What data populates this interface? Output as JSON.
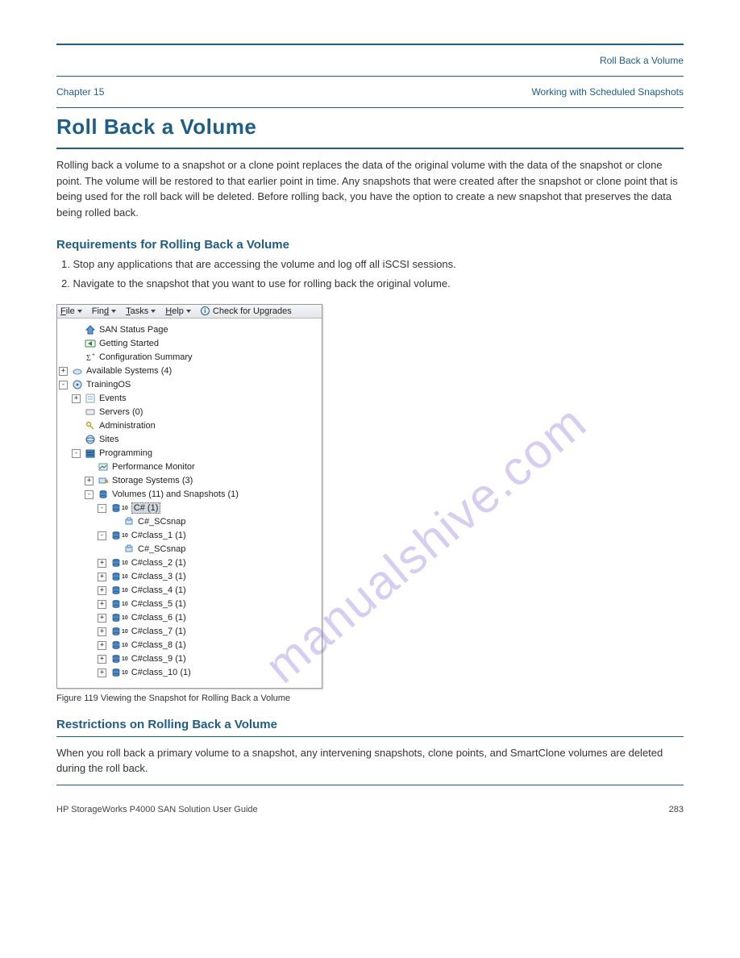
{
  "header_right": "Roll Back a Volume",
  "chapter_left": "Chapter 15",
  "chapter_right": "Working with Scheduled Snapshots",
  "title": "Roll Back a Volume",
  "intro": "Rolling back a volume to a snapshot or a clone point replaces the data of the original volume with the data of the snapshot or clone point. The volume will be restored to that earlier point in time. Any snapshots that were created after the snapshot or clone point that is being used for the roll back will be deleted. Before rolling back, you have the option to create a new snapshot that preserves the data being rolled back.",
  "subhead_req": "Requirements for Rolling Back a Volume",
  "req1": "1. Stop any applications that are accessing the volume and log off all iSCSI sessions.",
  "req2": "2. Navigate to the snapshot that you want to use for rolling back the original volume.",
  "menubar": {
    "file": "File",
    "find": "Find",
    "tasks": "Tasks",
    "help": "Help",
    "check": "Check for Upgrades"
  },
  "tree": {
    "san_status": "SAN Status Page",
    "getting_started": "Getting Started",
    "config_summary": "Configuration Summary",
    "available_systems": "Available Systems (4)",
    "trainingos": "TrainingOS",
    "events": "Events",
    "servers": "Servers (0)",
    "administration": "Administration",
    "sites": "Sites",
    "programming": "Programming",
    "perf_monitor": "Performance Monitor",
    "storage_systems": "Storage Systems (3)",
    "volumes": "Volumes (11) and Snapshots (1)",
    "csharp": "C# (1)",
    "scsnap1": "C#_SCsnap",
    "cc1": "C#class_1 (1)",
    "scsnap2": "C#_SCsnap",
    "cc2": "C#class_2 (1)",
    "cc3": "C#class_3 (1)",
    "cc4": "C#class_4 (1)",
    "cc5": "C#class_5 (1)",
    "cc6": "C#class_6 (1)",
    "cc7": "C#class_7 (1)",
    "cc8": "C#class_8 (1)",
    "cc9": "C#class_9 (1)",
    "cc10": "C#class_10 (1)"
  },
  "figure_caption": "Figure 119 Viewing the Snapshot for Rolling Back a Volume",
  "lower_head": "Restrictions on Rolling Back a Volume",
  "lower_body": "When you roll back a primary volume to a snapshot, any intervening snapshots, clone points, and SmartClone volumes are deleted during the roll back.",
  "footer_page": "283",
  "footer_title": "HP StorageWorks P4000 SAN Solution User Guide",
  "footer_right": ""
}
